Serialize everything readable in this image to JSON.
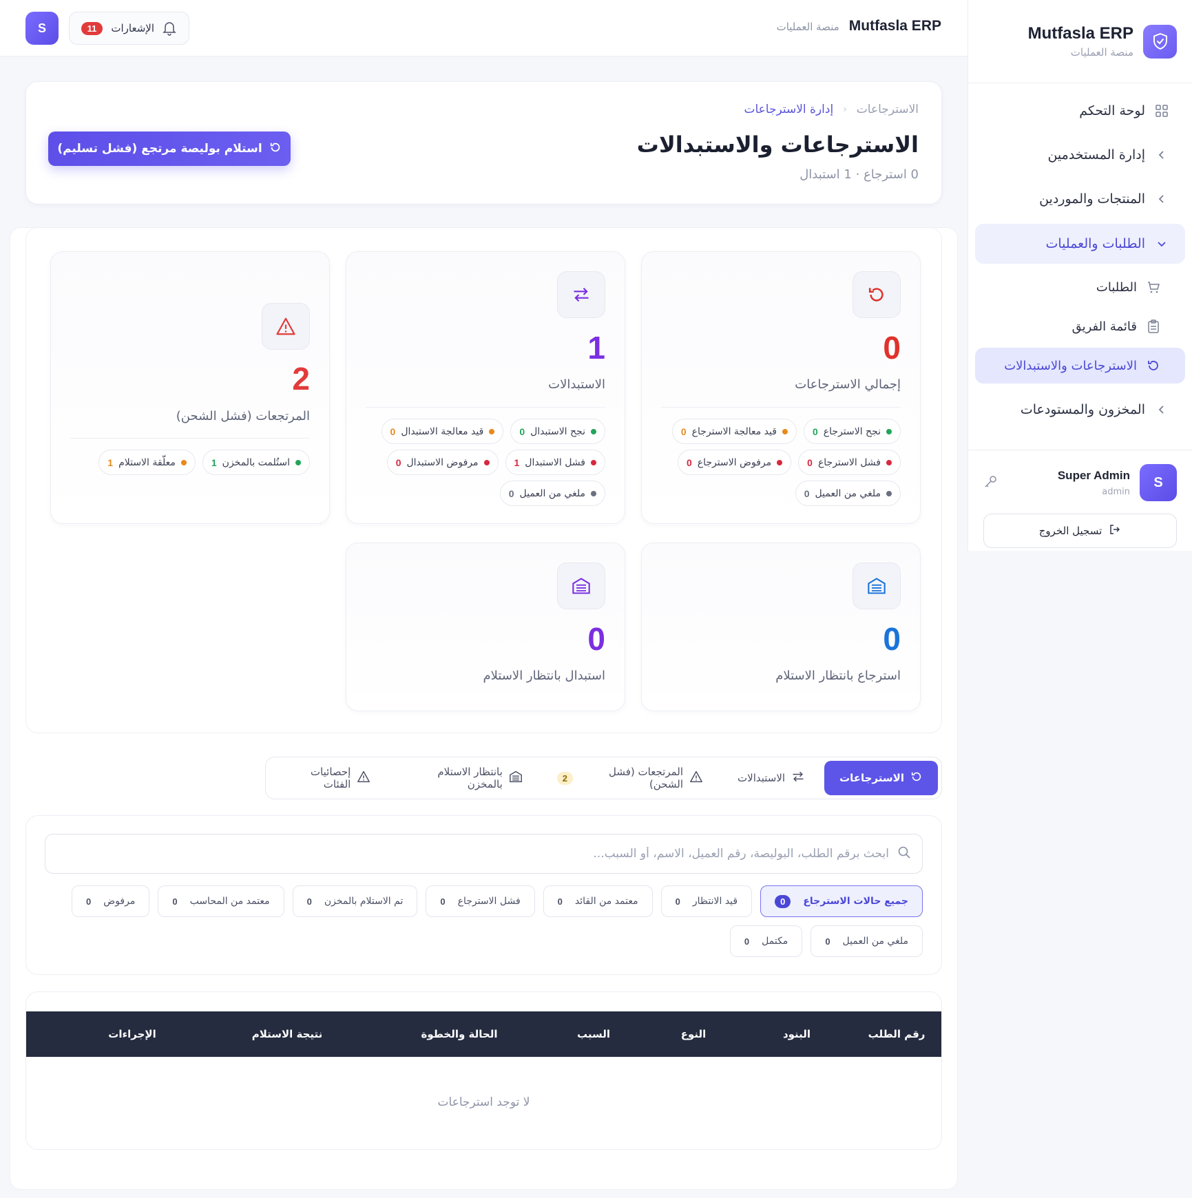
{
  "brand": {
    "name": "Mutfasla ERP",
    "subtitle": "منصة العمليات"
  },
  "sidebar": {
    "items": [
      {
        "label": "لوحة التحكم",
        "icon": "grid-icon"
      },
      {
        "label": "إدارة المستخدمين",
        "icon": "chevron-left-icon"
      },
      {
        "label": "المنتجات والموردين",
        "icon": "chevron-left-icon"
      },
      {
        "label": "الطلبات والعمليات",
        "icon": "chevron-down-icon"
      },
      {
        "label": "الطلبات",
        "icon": "cart-icon"
      },
      {
        "label": "قائمة الفريق",
        "icon": "clipboard-icon"
      },
      {
        "label": "الاسترجاعات والاستبدالات",
        "icon": "rotate-icon"
      },
      {
        "label": "المخزون والمستودعات",
        "icon": "chevron-left-icon"
      }
    ],
    "user": {
      "initial": "S",
      "name": "Super Admin",
      "role": "admin"
    },
    "logout_label": "تسجيل الخروج"
  },
  "topbar": {
    "brand_name": "Mutfasla ERP",
    "brand_sub": "منصة العمليات",
    "notifications_label": "الإشعارات",
    "notifications_count": "11",
    "avatar_initial": "S"
  },
  "header": {
    "breadcrumb": [
      "الاسترجاعات",
      "إدارة الاسترجاعات"
    ],
    "title": "الاسترجاعات والاستبدالات",
    "subtitle": "0 استرجاع · 1 استبدال",
    "primary_action": "استلام بوليصة مرتجع (فشل تسليم)"
  },
  "stats": {
    "returns": {
      "value": "0",
      "label": "إجمالي الاسترجاعات",
      "chips": [
        {
          "label": "نجح الاسترجاع",
          "value": "0",
          "color": "#22a55b"
        },
        {
          "label": "قيد معالجة الاسترجاع",
          "value": "0",
          "color": "#e8891c"
        },
        {
          "label": "فشل الاسترجاع",
          "value": "0",
          "color": "#d6283f"
        },
        {
          "label": "مرفوض الاسترجاع",
          "value": "0",
          "color": "#d6283f"
        },
        {
          "label": "ملغي من العميل",
          "value": "0",
          "color": "#6b7080"
        }
      ]
    },
    "exchanges": {
      "value": "1",
      "label": "الاستبدالات",
      "chips": [
        {
          "label": "نجح الاستبدال",
          "value": "0",
          "color": "#22a55b"
        },
        {
          "label": "قيد معالجة الاستبدال",
          "value": "0",
          "color": "#e8891c"
        },
        {
          "label": "فشل الاستبدال",
          "value": "1",
          "color": "#d6283f"
        },
        {
          "label": "مرفوض الاستبدال",
          "value": "0",
          "color": "#d6283f"
        },
        {
          "label": "ملغي من العميل",
          "value": "0",
          "color": "#6b7080"
        }
      ]
    },
    "failed_shipments": {
      "value": "2",
      "label": "المرتجعات (فشل الشحن)",
      "chips": [
        {
          "label": "استُلمت بالمخزن",
          "value": "1",
          "color": "#22a55b"
        },
        {
          "label": "معلّقة الاستلام",
          "value": "1",
          "color": "#e8891c"
        }
      ]
    },
    "pending_return_receipt": {
      "value": "0",
      "label": "استرجاع بانتظار الاستلام"
    },
    "pending_exchange_receipt": {
      "value": "0",
      "label": "استبدال بانتظار الاستلام"
    }
  },
  "colors": {
    "returns": "#e0322b",
    "exchanges": "#7b2fe0",
    "failed": "#e23b3b",
    "pending_return": "#1a74d9",
    "pending_exchange": "#7b2fe0",
    "accent": "#5d55e8"
  },
  "tabs": [
    {
      "label": "الاسترجاعات",
      "icon": "rotate-icon"
    },
    {
      "label": "الاستبدالات",
      "icon": "swap-icon"
    },
    {
      "label": "المرتجعات (فشل الشحن)",
      "icon": "warning-icon",
      "badge": "2"
    },
    {
      "label": "بانتظار الاستلام بالمخزن",
      "icon": "warehouse-icon"
    },
    {
      "label": "إحصائيات الفئات",
      "icon": "warning-icon"
    }
  ],
  "search": {
    "placeholder": "ابحث برقم الطلب، البوليصة، رقم العميل، الاسم، أو السبب..."
  },
  "filters": [
    {
      "label": "جميع حالات الاسترجاع",
      "value": "0"
    },
    {
      "label": "قيد الانتظار",
      "value": "0"
    },
    {
      "label": "معتمد من القائد",
      "value": "0"
    },
    {
      "label": "فشل الاسترجاع",
      "value": "0"
    },
    {
      "label": "تم الاستلام بالمخزن",
      "value": "0"
    },
    {
      "label": "معتمد من المحاسب",
      "value": "0"
    },
    {
      "label": "مرفوض",
      "value": "0"
    },
    {
      "label": "ملغي من العميل",
      "value": "0"
    },
    {
      "label": "مكتمل",
      "value": "0"
    }
  ],
  "table": {
    "columns": [
      "رقم الطلب",
      "البنود",
      "النوع",
      "السبب",
      "الحالة والخطوة",
      "نتيجة الاستلام",
      "الإجراءات"
    ],
    "empty": "لا توجد استرجاعات"
  }
}
